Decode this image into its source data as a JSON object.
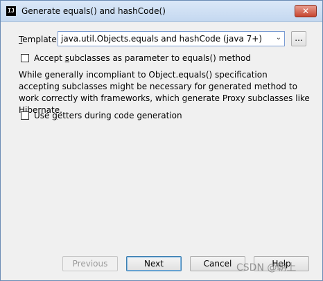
{
  "window": {
    "icon_text": "IJ",
    "title": "Generate equals() and hashCode()",
    "close_glyph": "✕"
  },
  "template": {
    "label_prefix": "T",
    "label_rest": "emplate:",
    "selected": "java.util.Objects.equals and hashCode (java 7+)",
    "dropdown_glyph": "⌄",
    "browse_label": "..."
  },
  "options": {
    "accept_subclasses": {
      "pre": "Accept ",
      "underlined": "s",
      "post": "ubclasses as parameter to equals() method",
      "checked": false
    },
    "description": "While generally incompliant to Object.equals() specification accepting subclasses might be necessary for generated method to work correctly with frameworks, which generate Proxy subclasses like Hibernate.",
    "use_getters": {
      "pre": "Use ",
      "underlined": "g",
      "post": "etters during code generation",
      "checked": false
    }
  },
  "buttons": {
    "previous": "Previous",
    "next": "Next",
    "cancel": "Cancel",
    "help": "Help"
  },
  "watermark": "CSDN @朝上"
}
